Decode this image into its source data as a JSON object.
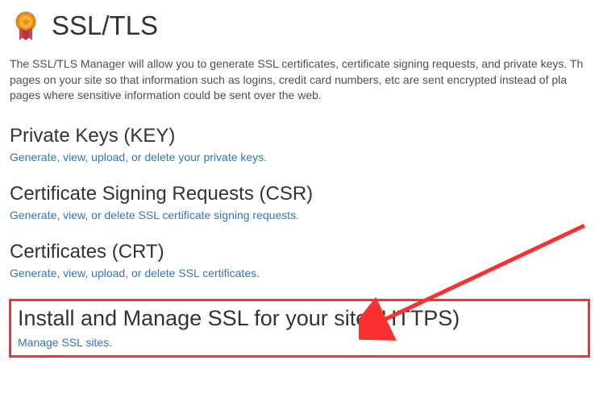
{
  "header": {
    "title": "SSL/TLS"
  },
  "intro": "The SSL/TLS Manager will allow you to generate SSL certificates, certificate signing requests, and private keys. Th pages on your site so that information such as logins, credit card numbers, etc are sent encrypted instead of pla pages where sensitive information could be sent over the web.",
  "sections": {
    "keys": {
      "title": "Private Keys (KEY)",
      "link": "Generate, view, upload, or delete your private keys."
    },
    "csr": {
      "title": "Certificate Signing Requests (CSR)",
      "link": "Generate, view, or delete SSL certificate signing requests."
    },
    "crt": {
      "title": "Certificates (CRT)",
      "link": "Generate, view, upload, or delete SSL certificates."
    },
    "install": {
      "title": "Install and Manage SSL for your site (HTTPS)",
      "link": "Manage SSL sites."
    }
  }
}
